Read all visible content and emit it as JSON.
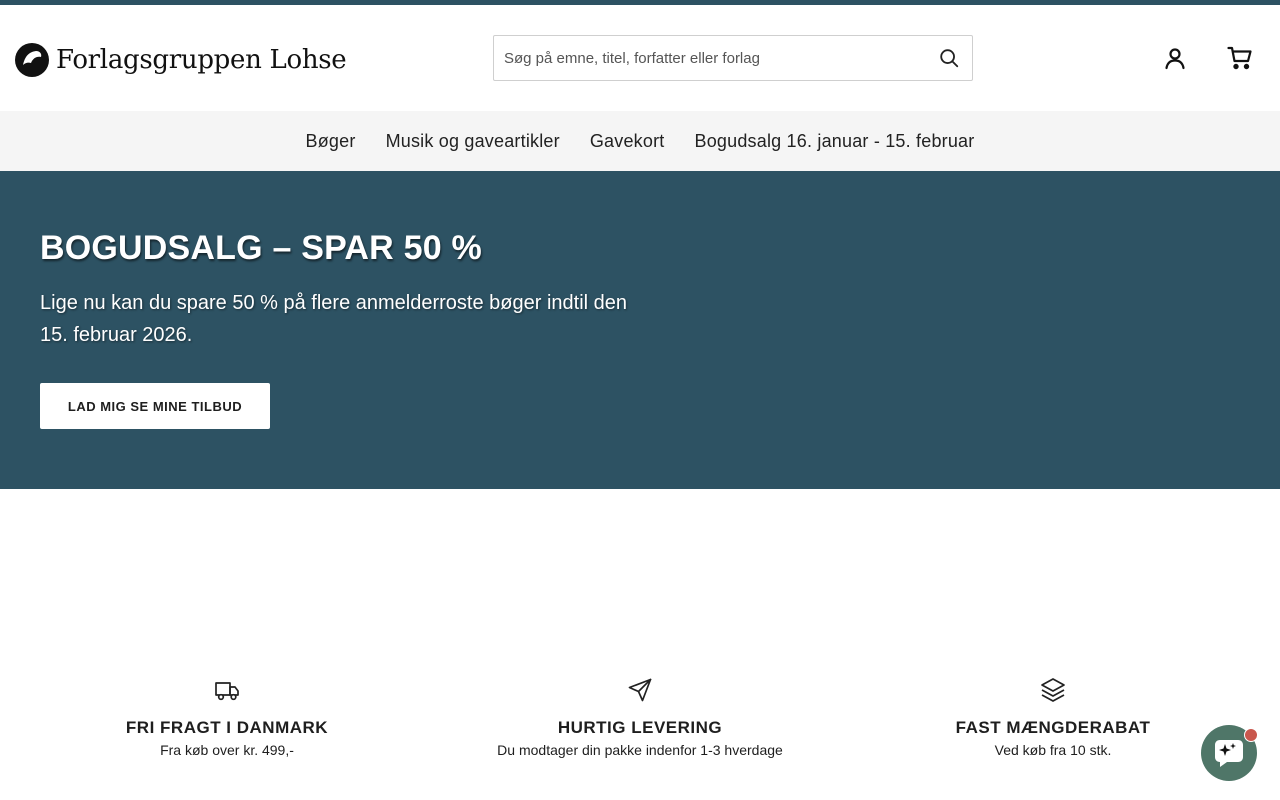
{
  "brand": {
    "name": "Forlagsgruppen Lohse",
    "accent": "#2d5263",
    "chat_color": "#4f7668"
  },
  "search": {
    "placeholder": "Søg på emne, titel, forfatter eller forlag",
    "value": ""
  },
  "nav": {
    "items": [
      {
        "label": "Bøger"
      },
      {
        "label": "Musik og gaveartikler"
      },
      {
        "label": "Gavekort"
      },
      {
        "label": "Bogudsalg 16. januar - 15. februar"
      }
    ]
  },
  "hero": {
    "title": "BOGUDSALG – SPAR 50 %",
    "text": "Lige nu kan du spare 50 % på flere anmelderroste bøger indtil den 15. februar 2026.",
    "cta": "LAD MIG SE MINE TILBUD"
  },
  "features": [
    {
      "icon": "truck-icon",
      "title": "FRI FRAGT I DANMARK",
      "subtitle": "Fra køb over kr. 499,-"
    },
    {
      "icon": "send-icon",
      "title": "HURTIG LEVERING",
      "subtitle": "Du modtager din pakke indenfor 1-3 hverdage"
    },
    {
      "icon": "layers-icon",
      "title": "FAST MÆNGDERABAT",
      "subtitle": "Ved køb fra 10 stk."
    }
  ],
  "icons": {
    "search": "search-icon",
    "account": "user-icon",
    "cart": "cart-icon",
    "chat": "chat-sparkle-icon"
  }
}
